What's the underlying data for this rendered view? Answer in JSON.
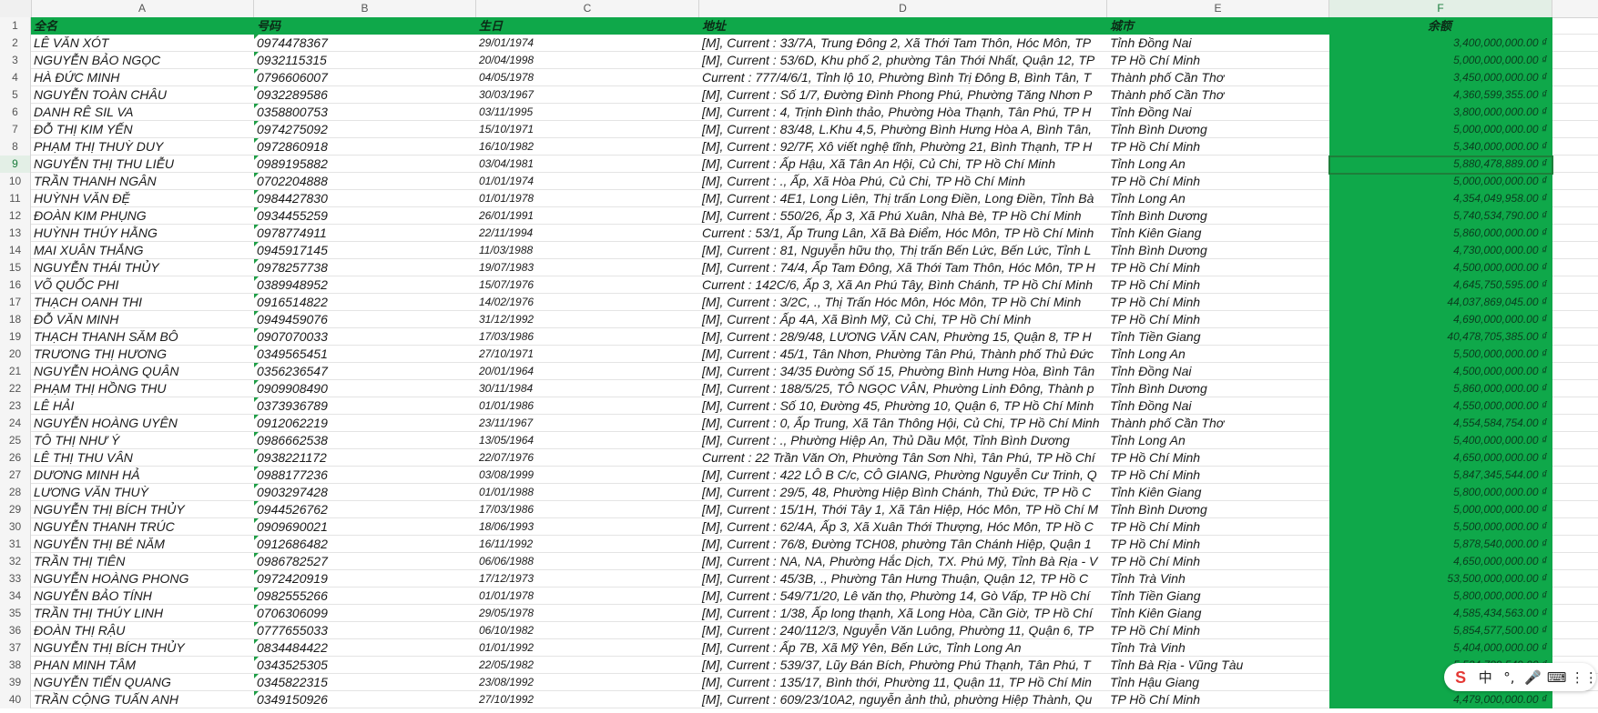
{
  "columns": [
    "A",
    "B",
    "C",
    "D",
    "E",
    "F"
  ],
  "header_row_number": "1",
  "headers": [
    "全名",
    "号码",
    "生日",
    "地址",
    "城市",
    "余额"
  ],
  "rows": [
    {
      "n": "2",
      "name": "LÊ VĂN XÓT",
      "phone": "0974478367",
      "dob": "29/01/1974",
      "addr": "[M], Current : 33/7A, Trung Đông 2, Xã Thới Tam Thôn, Hóc Môn, TP",
      "city": "Tỉnh Đồng Nai",
      "bal": "3,400,000,000.00 ₫"
    },
    {
      "n": "3",
      "name": "NGUYỄN BẢO NGỌC",
      "phone": "0932115315",
      "dob": "20/04/1998",
      "addr": "[M], Current : 53/6D, Khu phố 2, phường Tân Thới Nhất, Quận 12, TP",
      "city": "TP Hồ Chí Minh",
      "bal": "5,000,000,000.00 ₫"
    },
    {
      "n": "4",
      "name": "HÀ ĐỨC MINH",
      "phone": "0796606007",
      "dob": "04/05/1978",
      "addr": "Current : 777/4/6/1, Tỉnh lộ 10, Phường Bình Trị Đông B, Bình Tân, T",
      "city": "Thành phố Cần Thơ",
      "bal": "3,450,000,000.00 ₫"
    },
    {
      "n": "5",
      "name": "NGUYỄN TOÀN CHÂU",
      "phone": "0932289586",
      "dob": "30/03/1967",
      "addr": "[M], Current : Số 1/7, Đường Đình Phong Phú, Phường Tăng Nhơn P",
      "city": "Thành phố Cần Thơ",
      "bal": "4,360,599,355.00 ₫"
    },
    {
      "n": "6",
      "name": "DANH RÊ SIL VA",
      "phone": "0358800753",
      "dob": "03/11/1995",
      "addr": "[M], Current : 4, Trịnh Đình thảo, Phường Hòa Thạnh, Tân Phú, TP H",
      "city": "Tỉnh Đồng Nai",
      "bal": "3,800,000,000.00 ₫"
    },
    {
      "n": "7",
      "name": "ĐỖ THỊ KIM YẾN",
      "phone": "0974275092",
      "dob": "15/10/1971",
      "addr": "[M], Current : 83/48, L.Khu 4,5, Phường Bình Hưng Hòa A, Bình Tân,",
      "city": "Tỉnh Bình Dương",
      "bal": "5,000,000,000.00 ₫"
    },
    {
      "n": "8",
      "name": "PHẠM THỊ THUỲ DUY",
      "phone": "0972860918",
      "dob": "16/10/1982",
      "addr": "[M], Current : 92/7F, Xô viết nghệ tĩnh, Phường 21, Bình Thạnh, TP H",
      "city": "TP Hồ Chí Minh",
      "bal": "5,340,000,000.00 ₫"
    },
    {
      "n": "9",
      "name": "NGUYỄN THỊ THU LIỄU",
      "phone": "0989195882",
      "dob": "03/04/1981",
      "addr": "[M], Current : Ấp Hậu, Xã Tân An Hội, Củ Chi, TP Hồ Chí Minh",
      "city": "Tỉnh Long An",
      "bal": "5,880,478,889.00 ₫"
    },
    {
      "n": "10",
      "name": "TRẦN THANH NGÂN",
      "phone": "0702204888",
      "dob": "01/01/1974",
      "addr": "[M], Current : ., Ấp, Xã Hòa Phú, Củ Chi, TP Hồ Chí Minh",
      "city": "TP Hồ Chí Minh",
      "bal": "5,000,000,000.00 ₫"
    },
    {
      "n": "11",
      "name": "HUỲNH VĂN ĐỆ",
      "phone": "0984427830",
      "dob": "01/01/1978",
      "addr": "[M], Current : 4E1, Long Liên, Thị trấn Long Điền, Long Điền, Tỉnh Bà",
      "city": "Tỉnh Long An",
      "bal": "4,354,049,958.00 ₫"
    },
    {
      "n": "12",
      "name": "ĐOÀN KIM PHỤNG",
      "phone": "0934455259",
      "dob": "26/01/1991",
      "addr": "[M], Current : 550/26, Ấp 3, Xã Phú Xuân, Nhà Bè, TP Hồ Chí Minh",
      "city": "Tỉnh Bình Dương",
      "bal": "5,740,534,790.00 ₫"
    },
    {
      "n": "13",
      "name": "HUỲNH THÚY HẰNG",
      "phone": "0978774911",
      "dob": "22/11/1994",
      "addr": "Current : 53/1, Ấp Trung Lân, Xã Bà Điểm, Hóc Môn, TP Hồ Chí Minh",
      "city": "Tỉnh Kiên Giang",
      "bal": "5,860,000,000.00 ₫"
    },
    {
      "n": "14",
      "name": "MAI XUÂN THẮNG",
      "phone": "0945917145",
      "dob": "11/03/1988",
      "addr": "[M], Current : 81, Nguyễn hữu thọ, Thị trấn Bến Lức, Bến Lức, Tỉnh L",
      "city": "Tỉnh Bình Dương",
      "bal": "4,730,000,000.00 ₫"
    },
    {
      "n": "15",
      "name": "NGUYỄN THÁI THỦY",
      "phone": "0978257738",
      "dob": "19/07/1983",
      "addr": "[M], Current : 74/4, Ấp Tam Đông, Xã Thới Tam Thôn, Hóc Môn, TP H",
      "city": "TP Hồ Chí Minh",
      "bal": "4,500,000,000.00 ₫"
    },
    {
      "n": "16",
      "name": "VÕ QUỐC PHI",
      "phone": "0389948952",
      "dob": "15/07/1976",
      "addr": "Current : 142C/6, Ấp 3, Xã An Phú Tây, Bình Chánh, TP Hồ Chí Minh",
      "city": "TP Hồ Chí Minh",
      "bal": "4,645,750,595.00 ₫"
    },
    {
      "n": "17",
      "name": "THẠCH OANH THI",
      "phone": "0916514822",
      "dob": "14/02/1976",
      "addr": "[M], Current : 3/2C, ., Thị Trấn Hóc Môn, Hóc Môn, TP Hồ Chí Minh",
      "city": "TP Hồ Chí Minh",
      "bal": "44,037,869,045.00 ₫"
    },
    {
      "n": "18",
      "name": "ĐỖ VĂN MINH",
      "phone": "0949459076",
      "dob": "31/12/1992",
      "addr": "[M], Current : Ấp 4A, Xã Bình Mỹ, Củ Chi, TP Hồ Chí Minh",
      "city": "TP Hồ Chí Minh",
      "bal": "4,690,000,000.00 ₫"
    },
    {
      "n": "19",
      "name": "THẠCH THANH SĂM BÔ",
      "phone": "0907070033",
      "dob": "17/03/1986",
      "addr": "[M], Current : 28/9/48, LƯƠNG VĂN CAN, Phường 15, Quận 8, TP H",
      "city": "Tỉnh Tiền Giang",
      "bal": "40,478,705,385.00 ₫"
    },
    {
      "n": "20",
      "name": "TRƯƠNG THỊ HƯƠNG",
      "phone": "0349565451",
      "dob": "27/10/1971",
      "addr": "[M], Current : 45/1, Tân Nhơn, Phường Tân Phú, Thành phố Thủ Đức",
      "city": "Tỉnh Long An",
      "bal": "5,500,000,000.00 ₫"
    },
    {
      "n": "21",
      "name": "NGUYỄN HOÀNG QUÂN",
      "phone": "0356236547",
      "dob": "20/01/1964",
      "addr": "[M], Current : 34/35 Đường Số 15, Phường Bình Hưng Hòa, Bình Tân",
      "city": "Tỉnh Đồng Nai",
      "bal": "4,500,000,000.00 ₫"
    },
    {
      "n": "22",
      "name": "PHẠM THỊ HỒNG THU",
      "phone": "0909908490",
      "dob": "30/11/1984",
      "addr": "[M], Current : 188/5/25, TÔ NGỌC VÂN, Phường Linh Đông, Thành p",
      "city": "Tỉnh Bình Dương",
      "bal": "5,860,000,000.00 ₫"
    },
    {
      "n": "23",
      "name": "LÊ HẢI",
      "phone": "0373936789",
      "dob": "01/01/1986",
      "addr": "[M], Current : Số 10, Đường 45, Phường 10, Quận 6, TP Hồ Chí Minh",
      "city": "Tỉnh Đồng Nai",
      "bal": "4,550,000,000.00 ₫"
    },
    {
      "n": "24",
      "name": "NGUYỄN HOÀNG UYÊN",
      "phone": "0912062219",
      "dob": "23/11/1967",
      "addr": "[M], Current : 0, Ấp Trung, Xã Tân Thông Hội, Củ Chi, TP Hồ Chí Minh",
      "city": "Thành phố Cần Thơ",
      "bal": "4,554,584,754.00 ₫"
    },
    {
      "n": "25",
      "name": "TÔ THỊ NHƯ Ý",
      "phone": "0986662538",
      "dob": "13/05/1964",
      "addr": "[M], Current : ., Phường Hiệp An, Thủ Dầu Một, Tỉnh Bình Dương",
      "city": "Tỉnh Long An",
      "bal": "5,400,000,000.00 ₫"
    },
    {
      "n": "26",
      "name": "LÊ THỊ THU VÂN",
      "phone": "0938221172",
      "dob": "22/07/1976",
      "addr": "Current : 22 Trần Văn Ơn, Phường Tân Sơn Nhì, Tân Phú, TP Hồ Chí",
      "city": "TP Hồ Chí Minh",
      "bal": "4,650,000,000.00 ₫"
    },
    {
      "n": "27",
      "name": "DƯƠNG MINH HẢ",
      "phone": "0988177236",
      "dob": "03/08/1999",
      "addr": "[M], Current : 422 LÔ B C/c, CÔ GIANG, Phường Nguyễn Cư Trinh, Q",
      "city": "TP Hồ Chí Minh",
      "bal": "5,847,345,544.00 ₫"
    },
    {
      "n": "28",
      "name": "LƯƠNG VĂN THUỲ",
      "phone": "0903297428",
      "dob": "01/01/1988",
      "addr": "[M], Current : 29/5, 48, Phường Hiệp Bình Chánh, Thủ Đức, TP Hồ C",
      "city": "Tỉnh Kiên Giang",
      "bal": "5,800,000,000.00 ₫"
    },
    {
      "n": "29",
      "name": "NGUYỄN THỊ BÍCH THỦY",
      "phone": "0944526762",
      "dob": "17/03/1986",
      "addr": "[M], Current : 15/1H, Thới Tây 1, Xã Tân Hiệp, Hóc Môn, TP Hồ Chí M",
      "city": "Tỉnh Bình Dương",
      "bal": "5,000,000,000.00 ₫"
    },
    {
      "n": "30",
      "name": "NGUYỄN THANH TRÚC",
      "phone": "0909690021",
      "dob": "18/06/1993",
      "addr": "[M], Current : 62/4A, Ấp 3, Xã Xuân Thới Thượng, Hóc Môn, TP Hồ C",
      "city": "TP Hồ Chí Minh",
      "bal": "5,500,000,000.00 ₫"
    },
    {
      "n": "31",
      "name": "NGUYỄN THỊ BÉ NĂM",
      "phone": "0912686482",
      "dob": "16/11/1992",
      "addr": "[M], Current : 76/8, Đường TCH08, phường Tân Chánh Hiệp, Quận 1",
      "city": "TP Hồ Chí Minh",
      "bal": "5,878,540,000.00 ₫"
    },
    {
      "n": "32",
      "name": "TRẦN THỊ TIÊN",
      "phone": "0986782527",
      "dob": "06/06/1988",
      "addr": "[M], Current : NA, NA, Phường Hắc Dịch, TX. Phú Mỹ, Tỉnh Bà Rịa - V",
      "city": "TP Hồ Chí Minh",
      "bal": "4,650,000,000.00 ₫"
    },
    {
      "n": "33",
      "name": "NGUYỄN HOÀNG PHONG",
      "phone": "0972420919",
      "dob": "17/12/1973",
      "addr": "[M], Current : 45/3B, ., Phường Tân Hưng Thuận, Quận 12, TP Hồ C",
      "city": "Tỉnh Trà Vinh",
      "bal": "53,500,000,000.00 ₫"
    },
    {
      "n": "34",
      "name": "NGUYỄN BẢO TÍNH",
      "phone": "0982555266",
      "dob": "01/01/1978",
      "addr": "[M], Current : 549/71/20, Lê văn thọ, Phường 14, Gò Vấp, TP Hồ Chí",
      "city": "Tỉnh Tiền Giang",
      "bal": "5,800,000,000.00 ₫"
    },
    {
      "n": "35",
      "name": "TRẦN THỊ THÚY LINH",
      "phone": "0706306099",
      "dob": "29/05/1978",
      "addr": "[M], Current : 1/38, Ấp long thạnh, Xã Long Hòa, Cần Giờ, TP Hồ Chí",
      "city": "Tỉnh Kiên Giang",
      "bal": "4,585,434,563.00 ₫"
    },
    {
      "n": "36",
      "name": "ĐOÀN THỊ RẬU",
      "phone": "0777655033",
      "dob": "06/10/1982",
      "addr": "[M], Current : 240/112/3, Nguyễn Văn Luông, Phường 11, Quận 6, TP",
      "city": "TP Hồ Chí Minh",
      "bal": "5,854,577,500.00 ₫"
    },
    {
      "n": "37",
      "name": "NGUYỄN THỊ BÍCH THỦY",
      "phone": "0834484422",
      "dob": "01/01/1992",
      "addr": "[M], Current : Ấp 7B, Xã Mỹ Yên, Bến Lức, Tỉnh Long An",
      "city": "Tỉnh Trà Vinh",
      "bal": "5,404,000,000.00 ₫"
    },
    {
      "n": "38",
      "name": "PHAN MINH TÂM",
      "phone": "0343525305",
      "dob": "22/05/1982",
      "addr": "[M], Current : 539/37, Lũy Bán Bích, Phường Phú Thạnh, Tân Phú, T",
      "city": "Tỉnh Bà Rịa - Vũng Tàu",
      "bal": "5,534,789,549.00 ₫"
    },
    {
      "n": "39",
      "name": "NGUYỄN TIẾN QUANG",
      "phone": "0345822315",
      "dob": "23/08/1992",
      "addr": "[M], Current : 135/17, Bình thới, Phường 11, Quận 11, TP Hồ Chí Min",
      "city": "Tỉnh Hậu Giang",
      "bal": "5,800,000,000.00 ₫"
    },
    {
      "n": "40",
      "name": "TRẦN CỘNG TUẤN ANH",
      "phone": "0349150926",
      "dob": "27/10/1992",
      "addr": "[M], Current : 609/23/10A2, nguyễn ảnh thủ, phường Hiệp Thành, Qu",
      "city": "TP Hồ Chí Minh",
      "bal": "4,479,000,000.00 ₫"
    }
  ],
  "ime_toolbar": {
    "logo": "S",
    "lang": "中",
    "punct": "°,",
    "mic": "🎤",
    "keyboard": "⌨",
    "grid": "⋮⋮"
  }
}
